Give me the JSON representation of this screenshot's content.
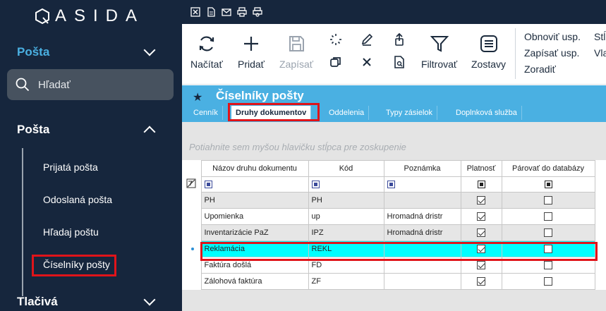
{
  "app": {
    "logo_text": "ASIDA"
  },
  "sidebar": {
    "section_posta_top": "Pošta",
    "search_placeholder": "Hľadať",
    "group_posta": "Pošta",
    "items": [
      {
        "label": "Prijatá pošta"
      },
      {
        "label": "Odoslaná pošta"
      },
      {
        "label": "Hľadaj poštu"
      },
      {
        "label": "Číselníky pošty"
      }
    ],
    "group_tlaciva": "Tlačivá"
  },
  "toolbar": {
    "nacitat": "Načítať",
    "pridat": "Pridať",
    "zapisat": "Zapísať",
    "filtrovat": "Filtrovať",
    "zostavy": "Zostavy",
    "obnovit_usp": "Obnoviť usp.",
    "zapisat_usp": "Zapísať usp.",
    "zoradit": "Zoradiť",
    "extra1": "Stĺ",
    "extra2": "Vla"
  },
  "page": {
    "title": "Číselníky pošty",
    "tabs": [
      {
        "label": "Cenník"
      },
      {
        "label": "Druhy dokumentov"
      },
      {
        "label": "Oddelenia"
      },
      {
        "label": "Typy zásielok"
      },
      {
        "label": "Doplnková služba"
      }
    ]
  },
  "grid": {
    "group_hint": "Potiahnite sem myšou hlavičku stĺpca pre zoskupenie",
    "columns": [
      "Názov druhu dokumentu",
      "Kód",
      "Poznámka",
      "Platnosť",
      "Párovať do databázy"
    ],
    "rows": [
      {
        "nazov": "PH",
        "kod": "PH",
        "poznamka": "",
        "platnost": true,
        "parovat": false
      },
      {
        "nazov": "Upomienka",
        "kod": "up",
        "poznamka": "Hromadná  dristr",
        "platnost": true,
        "parovat": false
      },
      {
        "nazov": "Inventarizácie PaZ",
        "kod": "IPZ",
        "poznamka": "Hromadná  dristr",
        "platnost": true,
        "parovat": false
      },
      {
        "nazov": "Reklamácia",
        "kod": "REKL",
        "poznamka": "",
        "platnost": true,
        "parovat": false
      },
      {
        "nazov": "Faktúra došlá",
        "kod": "FD",
        "poznamka": "",
        "platnost": true,
        "parovat": false
      },
      {
        "nazov": "Zálohová faktúra",
        "kod": "ZF",
        "poznamka": "",
        "platnost": true,
        "parovat": false
      }
    ]
  },
  "colors": {
    "sidebar_bg": "#16263d",
    "title_bar": "#4ab0e2",
    "selected_row": "#00ffff",
    "highlight_box": "#e0141a"
  }
}
